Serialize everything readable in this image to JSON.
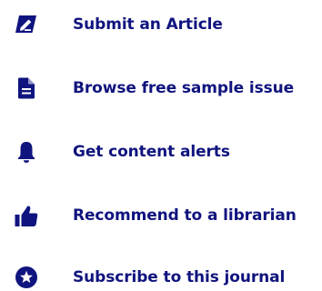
{
  "colors": {
    "icon": "#10147e",
    "link": "#10147e"
  },
  "actions": [
    {
      "icon": "pencil-square-icon",
      "label": "Submit an Article"
    },
    {
      "icon": "document-icon",
      "label": "Browse free sample issue"
    },
    {
      "icon": "bell-icon",
      "label": "Get content alerts"
    },
    {
      "icon": "thumbs-up-icon",
      "label": "Recommend to a librarian"
    },
    {
      "icon": "star-circle-icon",
      "label": "Subscribe to this journal"
    }
  ]
}
